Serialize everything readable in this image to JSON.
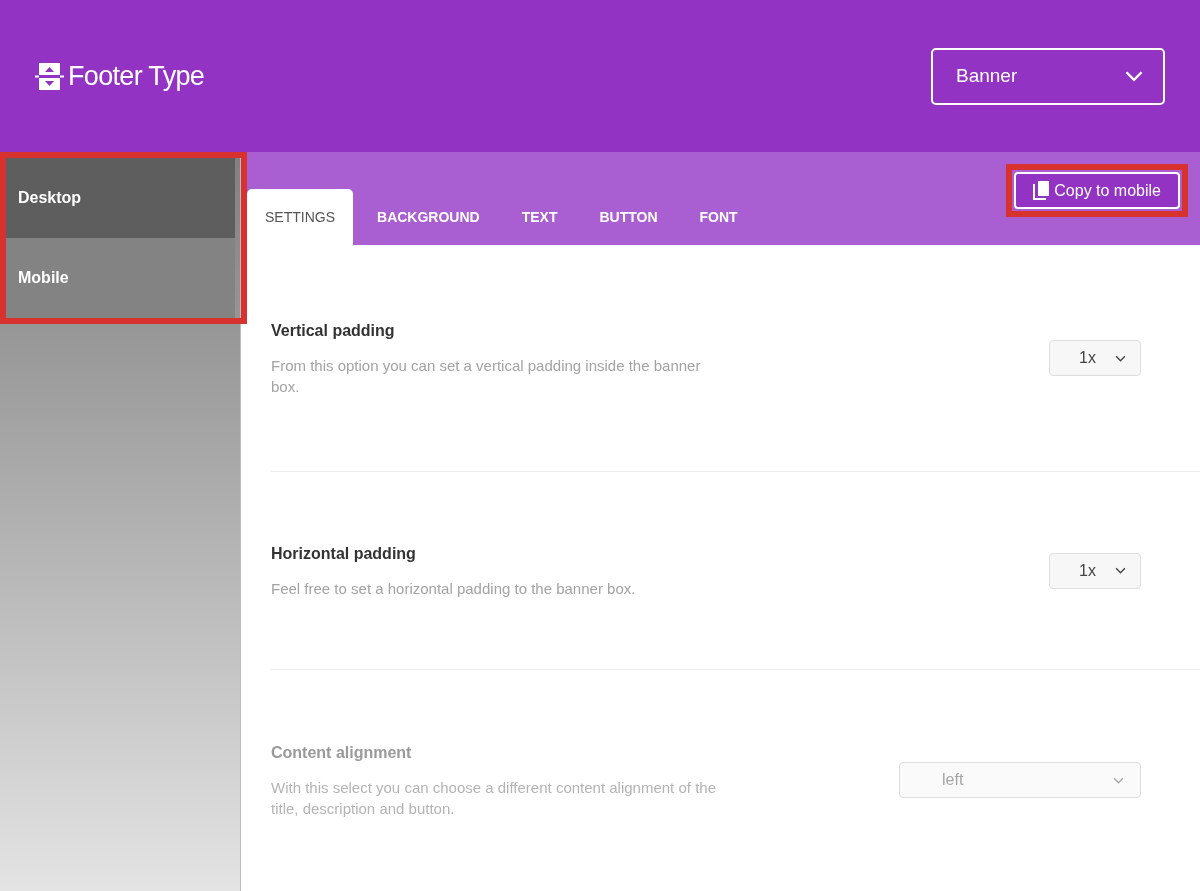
{
  "header": {
    "title": "Footer Type",
    "type_select": {
      "value": "Banner"
    }
  },
  "sidebar": {
    "highlighted": true,
    "items": [
      {
        "label": "Desktop",
        "selected": true
      },
      {
        "label": "Mobile",
        "selected": false
      }
    ]
  },
  "tabs": [
    {
      "label": "SETTINGS",
      "selected": true
    },
    {
      "label": "BACKGROUND",
      "selected": false
    },
    {
      "label": "TEXT",
      "selected": false
    },
    {
      "label": "BUTTON",
      "selected": false
    },
    {
      "label": "FONT",
      "selected": false
    }
  ],
  "copy_button": {
    "label": "Copy to mobile",
    "highlighted": true
  },
  "settings": [
    {
      "title": "Vertical padding",
      "description": "From this option you can set a vertical padding inside the banner box.",
      "value": "1x",
      "kind": "small",
      "disabled": false
    },
    {
      "title": "Horizontal padding",
      "description": "Feel free to set a horizontal padding to the banner box.",
      "value": "1x",
      "kind": "small",
      "disabled": false
    },
    {
      "title": "Content alignment",
      "description": "With this select you can choose a different content alignment of the title, description and button.",
      "value": "left",
      "kind": "wide",
      "disabled": true
    }
  ]
}
